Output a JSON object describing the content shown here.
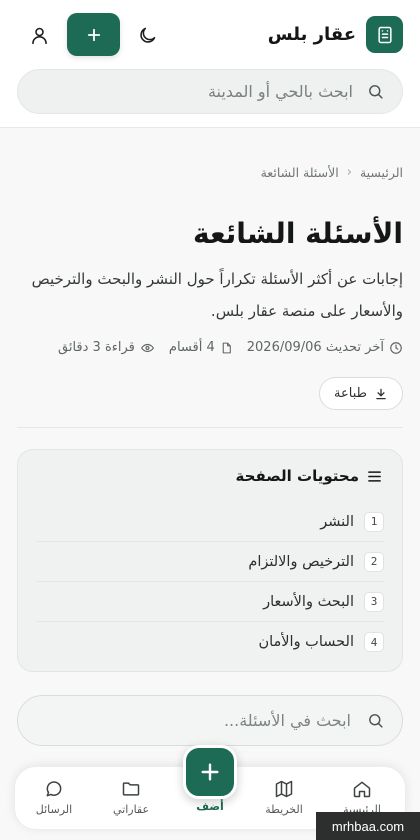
{
  "header": {
    "brand_name": "عقار بلس",
    "search_placeholder": "ابحث بالحي أو المدينة"
  },
  "breadcrumb": {
    "home": "الرئيسية",
    "current": "الأسئلة الشائعة"
  },
  "page": {
    "title": "الأسئلة الشائعة",
    "intro": "إجابات عن أكثر الأسئلة تكراراً حول النشر والبحث والترخيص والأسعار على منصة عقار بلس."
  },
  "meta": {
    "updated": "آخر تحديث 2026/09/06",
    "sections": "4 أقسام",
    "reading": "قراءة 3 دقائق"
  },
  "print_label": "طباعة",
  "toc": {
    "heading": "محتويات الصفحة",
    "items": [
      {
        "num": "1",
        "label": "النشر"
      },
      {
        "num": "2",
        "label": "الترخيص والالتزام"
      },
      {
        "num": "3",
        "label": "البحث والأسعار"
      },
      {
        "num": "4",
        "label": "الحساب والأمان"
      }
    ]
  },
  "faq_search": {
    "placeholder": "ابحث في الأسئلة..."
  },
  "bottom_nav": {
    "home": "الرئيسية",
    "map": "الخريطة",
    "add": "أضف",
    "properties": "عقاراتي",
    "messages": "الرسائل"
  },
  "watermark": "mrhbaa.com",
  "colors": {
    "accent": "#1d6b55",
    "background": "#f7f8f7"
  }
}
